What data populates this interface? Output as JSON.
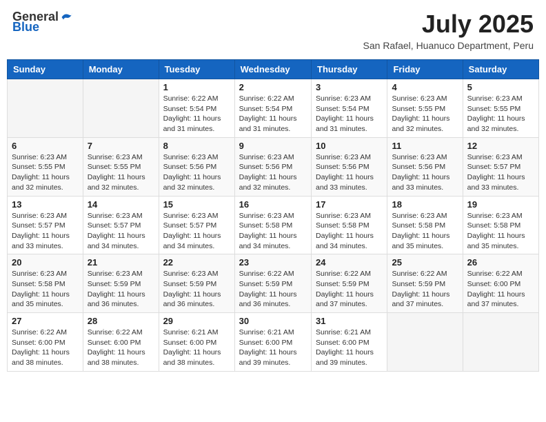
{
  "header": {
    "logo_general": "General",
    "logo_blue": "Blue",
    "month": "July 2025",
    "location": "San Rafael, Huanuco Department, Peru"
  },
  "days_of_week": [
    "Sunday",
    "Monday",
    "Tuesday",
    "Wednesday",
    "Thursday",
    "Friday",
    "Saturday"
  ],
  "weeks": [
    [
      {
        "day": "",
        "sunrise": "",
        "sunset": "",
        "daylight": ""
      },
      {
        "day": "",
        "sunrise": "",
        "sunset": "",
        "daylight": ""
      },
      {
        "day": "1",
        "sunrise": "Sunrise: 6:22 AM",
        "sunset": "Sunset: 5:54 PM",
        "daylight": "Daylight: 11 hours and 31 minutes."
      },
      {
        "day": "2",
        "sunrise": "Sunrise: 6:22 AM",
        "sunset": "Sunset: 5:54 PM",
        "daylight": "Daylight: 11 hours and 31 minutes."
      },
      {
        "day": "3",
        "sunrise": "Sunrise: 6:23 AM",
        "sunset": "Sunset: 5:54 PM",
        "daylight": "Daylight: 11 hours and 31 minutes."
      },
      {
        "day": "4",
        "sunrise": "Sunrise: 6:23 AM",
        "sunset": "Sunset: 5:55 PM",
        "daylight": "Daylight: 11 hours and 32 minutes."
      },
      {
        "day": "5",
        "sunrise": "Sunrise: 6:23 AM",
        "sunset": "Sunset: 5:55 PM",
        "daylight": "Daylight: 11 hours and 32 minutes."
      }
    ],
    [
      {
        "day": "6",
        "sunrise": "Sunrise: 6:23 AM",
        "sunset": "Sunset: 5:55 PM",
        "daylight": "Daylight: 11 hours and 32 minutes."
      },
      {
        "day": "7",
        "sunrise": "Sunrise: 6:23 AM",
        "sunset": "Sunset: 5:55 PM",
        "daylight": "Daylight: 11 hours and 32 minutes."
      },
      {
        "day": "8",
        "sunrise": "Sunrise: 6:23 AM",
        "sunset": "Sunset: 5:56 PM",
        "daylight": "Daylight: 11 hours and 32 minutes."
      },
      {
        "day": "9",
        "sunrise": "Sunrise: 6:23 AM",
        "sunset": "Sunset: 5:56 PM",
        "daylight": "Daylight: 11 hours and 32 minutes."
      },
      {
        "day": "10",
        "sunrise": "Sunrise: 6:23 AM",
        "sunset": "Sunset: 5:56 PM",
        "daylight": "Daylight: 11 hours and 33 minutes."
      },
      {
        "day": "11",
        "sunrise": "Sunrise: 6:23 AM",
        "sunset": "Sunset: 5:56 PM",
        "daylight": "Daylight: 11 hours and 33 minutes."
      },
      {
        "day": "12",
        "sunrise": "Sunrise: 6:23 AM",
        "sunset": "Sunset: 5:57 PM",
        "daylight": "Daylight: 11 hours and 33 minutes."
      }
    ],
    [
      {
        "day": "13",
        "sunrise": "Sunrise: 6:23 AM",
        "sunset": "Sunset: 5:57 PM",
        "daylight": "Daylight: 11 hours and 33 minutes."
      },
      {
        "day": "14",
        "sunrise": "Sunrise: 6:23 AM",
        "sunset": "Sunset: 5:57 PM",
        "daylight": "Daylight: 11 hours and 34 minutes."
      },
      {
        "day": "15",
        "sunrise": "Sunrise: 6:23 AM",
        "sunset": "Sunset: 5:57 PM",
        "daylight": "Daylight: 11 hours and 34 minutes."
      },
      {
        "day": "16",
        "sunrise": "Sunrise: 6:23 AM",
        "sunset": "Sunset: 5:58 PM",
        "daylight": "Daylight: 11 hours and 34 minutes."
      },
      {
        "day": "17",
        "sunrise": "Sunrise: 6:23 AM",
        "sunset": "Sunset: 5:58 PM",
        "daylight": "Daylight: 11 hours and 34 minutes."
      },
      {
        "day": "18",
        "sunrise": "Sunrise: 6:23 AM",
        "sunset": "Sunset: 5:58 PM",
        "daylight": "Daylight: 11 hours and 35 minutes."
      },
      {
        "day": "19",
        "sunrise": "Sunrise: 6:23 AM",
        "sunset": "Sunset: 5:58 PM",
        "daylight": "Daylight: 11 hours and 35 minutes."
      }
    ],
    [
      {
        "day": "20",
        "sunrise": "Sunrise: 6:23 AM",
        "sunset": "Sunset: 5:58 PM",
        "daylight": "Daylight: 11 hours and 35 minutes."
      },
      {
        "day": "21",
        "sunrise": "Sunrise: 6:23 AM",
        "sunset": "Sunset: 5:59 PM",
        "daylight": "Daylight: 11 hours and 36 minutes."
      },
      {
        "day": "22",
        "sunrise": "Sunrise: 6:23 AM",
        "sunset": "Sunset: 5:59 PM",
        "daylight": "Daylight: 11 hours and 36 minutes."
      },
      {
        "day": "23",
        "sunrise": "Sunrise: 6:22 AM",
        "sunset": "Sunset: 5:59 PM",
        "daylight": "Daylight: 11 hours and 36 minutes."
      },
      {
        "day": "24",
        "sunrise": "Sunrise: 6:22 AM",
        "sunset": "Sunset: 5:59 PM",
        "daylight": "Daylight: 11 hours and 37 minutes."
      },
      {
        "day": "25",
        "sunrise": "Sunrise: 6:22 AM",
        "sunset": "Sunset: 5:59 PM",
        "daylight": "Daylight: 11 hours and 37 minutes."
      },
      {
        "day": "26",
        "sunrise": "Sunrise: 6:22 AM",
        "sunset": "Sunset: 6:00 PM",
        "daylight": "Daylight: 11 hours and 37 minutes."
      }
    ],
    [
      {
        "day": "27",
        "sunrise": "Sunrise: 6:22 AM",
        "sunset": "Sunset: 6:00 PM",
        "daylight": "Daylight: 11 hours and 38 minutes."
      },
      {
        "day": "28",
        "sunrise": "Sunrise: 6:22 AM",
        "sunset": "Sunset: 6:00 PM",
        "daylight": "Daylight: 11 hours and 38 minutes."
      },
      {
        "day": "29",
        "sunrise": "Sunrise: 6:21 AM",
        "sunset": "Sunset: 6:00 PM",
        "daylight": "Daylight: 11 hours and 38 minutes."
      },
      {
        "day": "30",
        "sunrise": "Sunrise: 6:21 AM",
        "sunset": "Sunset: 6:00 PM",
        "daylight": "Daylight: 11 hours and 39 minutes."
      },
      {
        "day": "31",
        "sunrise": "Sunrise: 6:21 AM",
        "sunset": "Sunset: 6:00 PM",
        "daylight": "Daylight: 11 hours and 39 minutes."
      },
      {
        "day": "",
        "sunrise": "",
        "sunset": "",
        "daylight": ""
      },
      {
        "day": "",
        "sunrise": "",
        "sunset": "",
        "daylight": ""
      }
    ]
  ]
}
